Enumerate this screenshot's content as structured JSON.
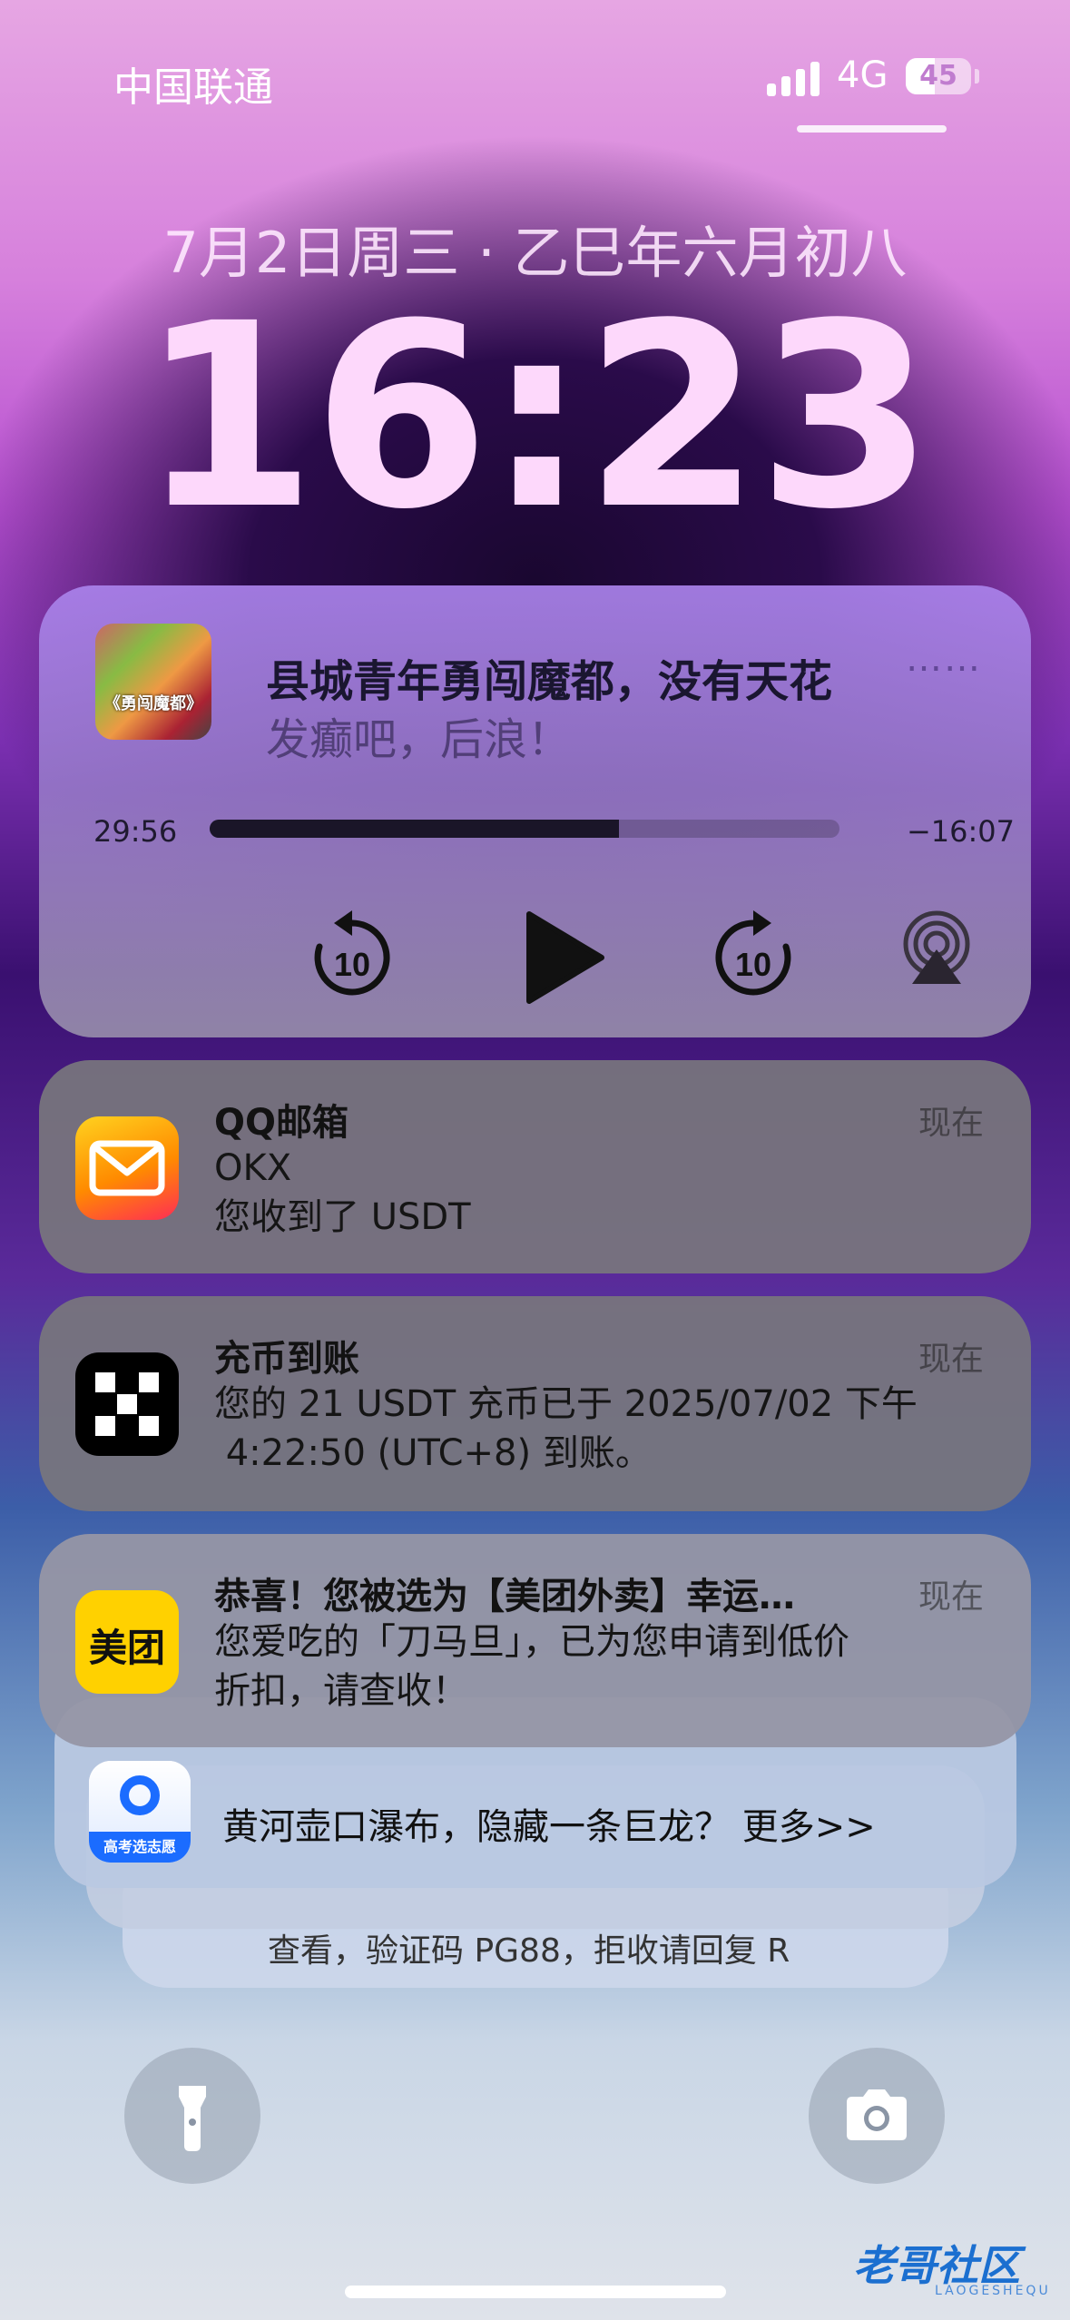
{
  "status_bar": {
    "carrier": "中国联通",
    "network": "4G",
    "battery": "45"
  },
  "lock": {
    "date": "7月2日周三 · 乙巳年六月初八",
    "time": "16:23"
  },
  "media": {
    "artwork_label": "《勇闯魔都》",
    "title": "县城青年勇闯魔都，没有天花",
    "artist": "发癫吧，后浪！",
    "elapsed": "29:56",
    "remaining": "−16:07",
    "progress": 0.65,
    "skip_back_label": "10",
    "skip_forward_label": "10"
  },
  "notifications": [
    {
      "app": "QQ邮箱",
      "time": "现在",
      "lines": [
        "OKX",
        "您收到了 USDT"
      ],
      "icon": "mail-icon"
    },
    {
      "app": "充币到账",
      "time": "现在",
      "lines": [
        "您的 21 USDT 充币已于 2025/07/02 下午",
        " 4:22:50 (UTC+8) 到账。"
      ],
      "icon": "okx-icon"
    },
    {
      "app": "恭喜！您被选为【美团外卖】幸运…",
      "time": "现在",
      "lines": [
        "您爱吃的「刀马旦」，已为您申请到低价",
        "折扣，请查收！"
      ],
      "icon_text": "美团"
    }
  ],
  "stacked": {
    "app_icon_text": "高考选志愿",
    "line": "黄河壶口瀑布，隐藏一条巨龙？ 更多>>",
    "line2": "查看，验证码 PG88，拒收请回复 R"
  },
  "watermark": {
    "text": "老哥社区",
    "sub": "LAOGESHEQU"
  },
  "colors": {
    "qq_mail_gradient": [
      "#ffd21f",
      "#ff8a00",
      "#ff2d55"
    ],
    "meituan_yellow": "#ffd100",
    "okx_black": "#000000"
  }
}
